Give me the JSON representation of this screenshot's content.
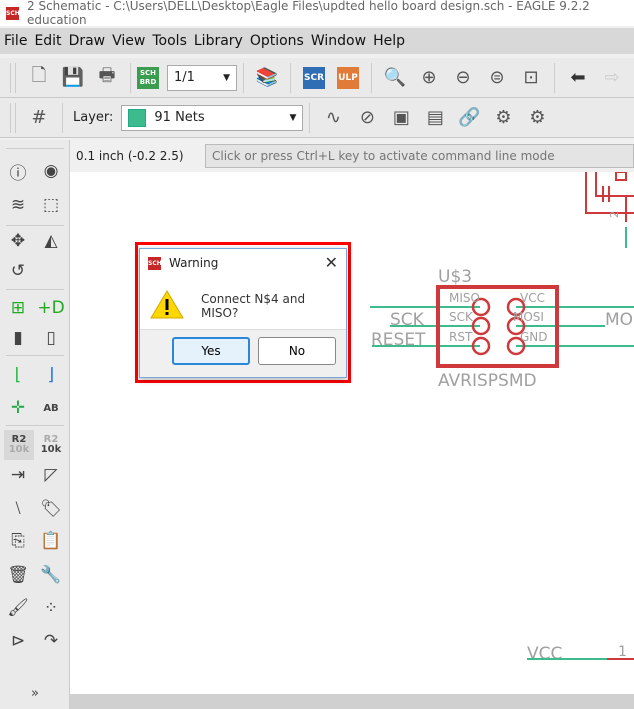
{
  "window": {
    "title": "2 Schematic - C:\\Users\\DELL\\Desktop\\Eagle Files\\updted hello board design.sch - EAGLE 9.2.2 education",
    "app_icon_text": "SCH"
  },
  "menu": [
    "File",
    "Edit",
    "Draw",
    "View",
    "Tools",
    "Library",
    "Options",
    "Window",
    "Help"
  ],
  "toolbar1": {
    "sheet_value": "1/1",
    "sch_brd": "SCH BRD",
    "scr": "SCR",
    "ulp": "ULP"
  },
  "toolbar2": {
    "layer_label": "Layer:",
    "layer_value": "91 Nets",
    "layer_color": "#3dbb8c"
  },
  "command": {
    "grid_coord": "0.1 inch (-0.2 2.5)",
    "placeholder": "Click or press Ctrl+L key to activate command line mode"
  },
  "lefttoolbar": {
    "value_label_top": "R2",
    "value_label_bottom": "10k"
  },
  "schematic": {
    "part_name": "U$3",
    "part_value": "AVRISPSMD",
    "pins_left": [
      "MISO",
      "SCK",
      "RST"
    ],
    "pins_right": [
      "VCC",
      "MOSI",
      "GND"
    ],
    "net_labels": [
      "SCK",
      "RESET",
      "MO",
      "VCC"
    ],
    "pin_numbers": [
      "2",
      "1"
    ],
    "colors": {
      "net": "#3dbb8c",
      "symbol": "#d0393b",
      "text": "#a0a0a0"
    }
  },
  "dialog": {
    "title": "Warning",
    "message": "Connect N$4 and MISO?",
    "yes": "Yes",
    "no": "No",
    "highlight_color": "#ff0000"
  }
}
